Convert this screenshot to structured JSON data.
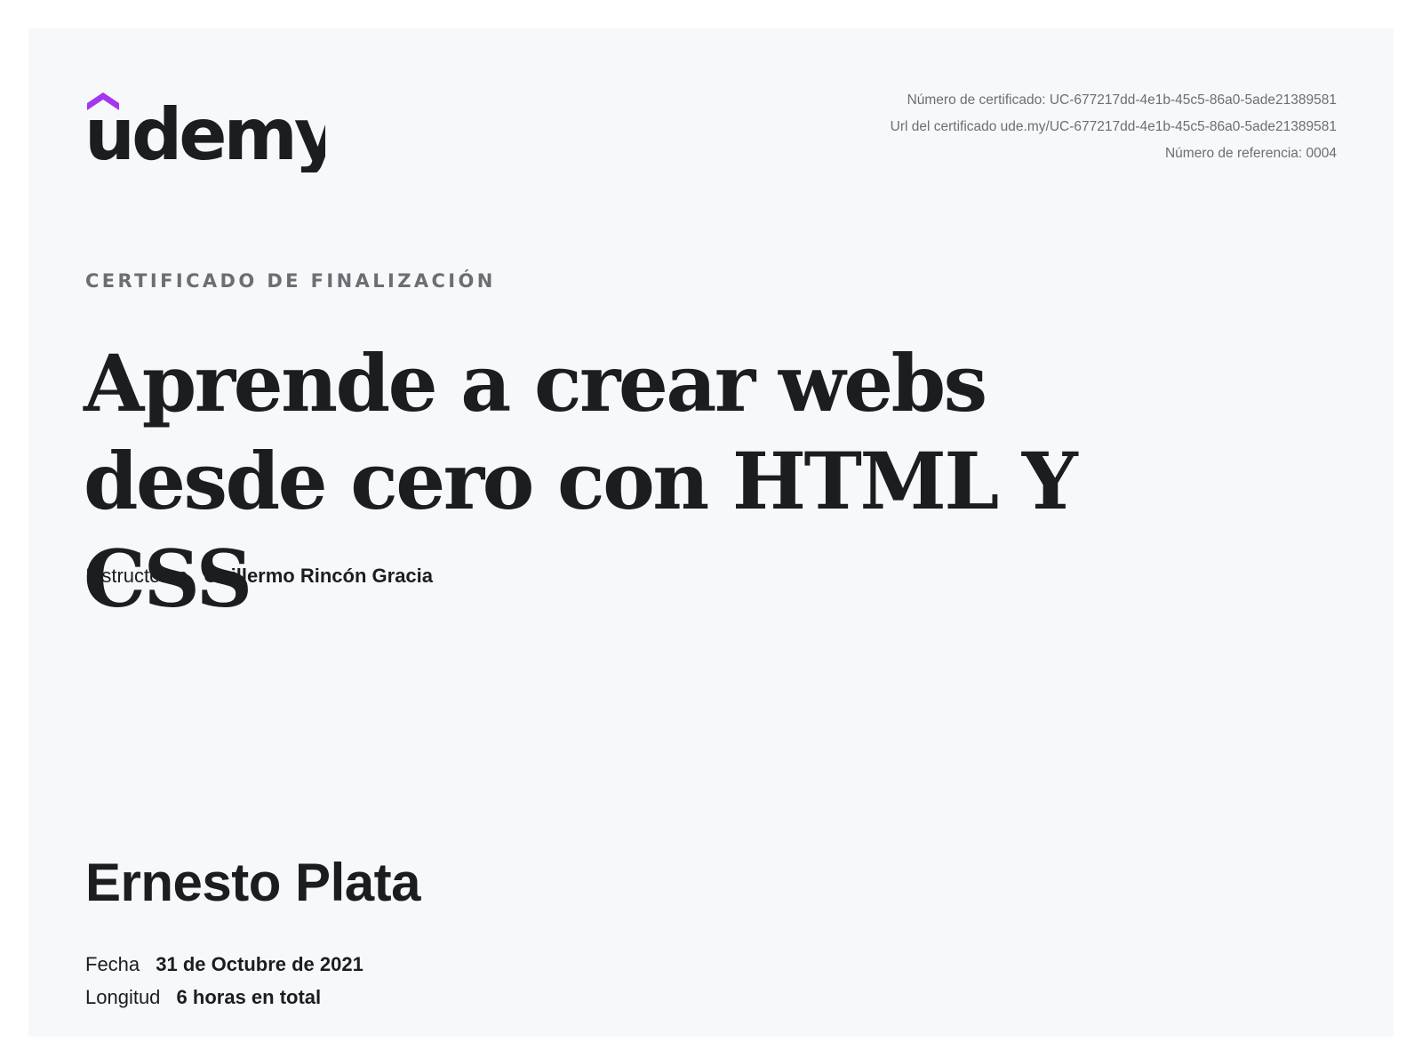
{
  "brand": {
    "logo_text": "udemy",
    "accent_color": "#a435f0",
    "text_color": "#1c1d1f"
  },
  "certificate_meta": {
    "number": "Número de certificado: UC-677217dd-4e1b-45c5-86a0-5ade21389581",
    "url": "Url del certificado ude.my/UC-677217dd-4e1b-45c5-86a0-5ade21389581",
    "reference": "Número de referencia: 0004"
  },
  "kicker": "CERTIFICADO DE FINALIZACIÓN",
  "course": {
    "title": "Aprende a crear webs desde cero con HTML Y CSS"
  },
  "instructors": {
    "label": "Instructores",
    "value": "Guillermo Rincón Gracia"
  },
  "student": {
    "name": "Ernesto Plata"
  },
  "details": {
    "date_label": "Fecha",
    "date_value": "31 de Octubre de 2021",
    "length_label": "Longitud",
    "length_value": "6 horas en total"
  }
}
